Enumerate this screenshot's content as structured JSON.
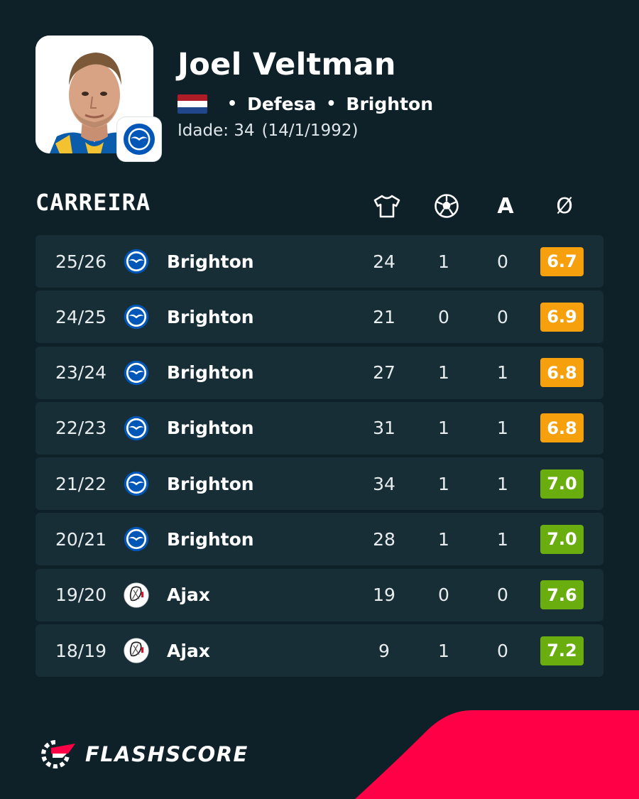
{
  "player": {
    "name": "Joel Veltman",
    "position": "Defesa",
    "club": "Brighton",
    "age_label": "Idade: 34",
    "birth_date": "(14/1/1992)",
    "nationality_flag_icon": "netherlands-flag-icon",
    "flag_colors": [
      "#ae1c28",
      "#ffffff",
      "#21468b"
    ]
  },
  "section": {
    "title": "CARREIRA",
    "columns": [
      {
        "name": "appearances",
        "icon": "shirt-icon"
      },
      {
        "name": "goals",
        "icon": "ball-icon"
      },
      {
        "name": "assists",
        "label": "A"
      },
      {
        "name": "average-rating",
        "label": "Ø"
      }
    ]
  },
  "career": [
    {
      "season": "25/26",
      "club": "Brighton",
      "logo_icon": "brighton-logo-icon",
      "apps": "24",
      "goals": "1",
      "assists": "0",
      "rating": "6.7",
      "rating_color": "#f5a00c"
    },
    {
      "season": "24/25",
      "club": "Brighton",
      "logo_icon": "brighton-logo-icon",
      "apps": "21",
      "goals": "0",
      "assists": "0",
      "rating": "6.9",
      "rating_color": "#f5a00c"
    },
    {
      "season": "23/24",
      "club": "Brighton",
      "logo_icon": "brighton-logo-icon",
      "apps": "27",
      "goals": "1",
      "assists": "1",
      "rating": "6.8",
      "rating_color": "#f5a00c"
    },
    {
      "season": "22/23",
      "club": "Brighton",
      "logo_icon": "brighton-logo-icon",
      "apps": "31",
      "goals": "1",
      "assists": "1",
      "rating": "6.8",
      "rating_color": "#f5a00c"
    },
    {
      "season": "21/22",
      "club": "Brighton",
      "logo_icon": "brighton-logo-icon",
      "apps": "34",
      "goals": "1",
      "assists": "1",
      "rating": "7.0",
      "rating_color": "#6aad0e"
    },
    {
      "season": "20/21",
      "club": "Brighton",
      "logo_icon": "brighton-logo-icon",
      "apps": "28",
      "goals": "1",
      "assists": "1",
      "rating": "7.0",
      "rating_color": "#6aad0e"
    },
    {
      "season": "19/20",
      "club": "Ajax",
      "logo_icon": "ajax-logo-icon",
      "apps": "19",
      "goals": "0",
      "assists": "0",
      "rating": "7.6",
      "rating_color": "#6aad0e"
    },
    {
      "season": "18/19",
      "club": "Ajax",
      "logo_icon": "ajax-logo-icon",
      "apps": "9",
      "goals": "1",
      "assists": "0",
      "rating": "7.2",
      "rating_color": "#6aad0e"
    }
  ],
  "footer": {
    "brand": "FLASHSCORE",
    "accent_color": "#ff0046"
  },
  "theme": {
    "background": "#0f2128",
    "row_background": "#172e37"
  }
}
